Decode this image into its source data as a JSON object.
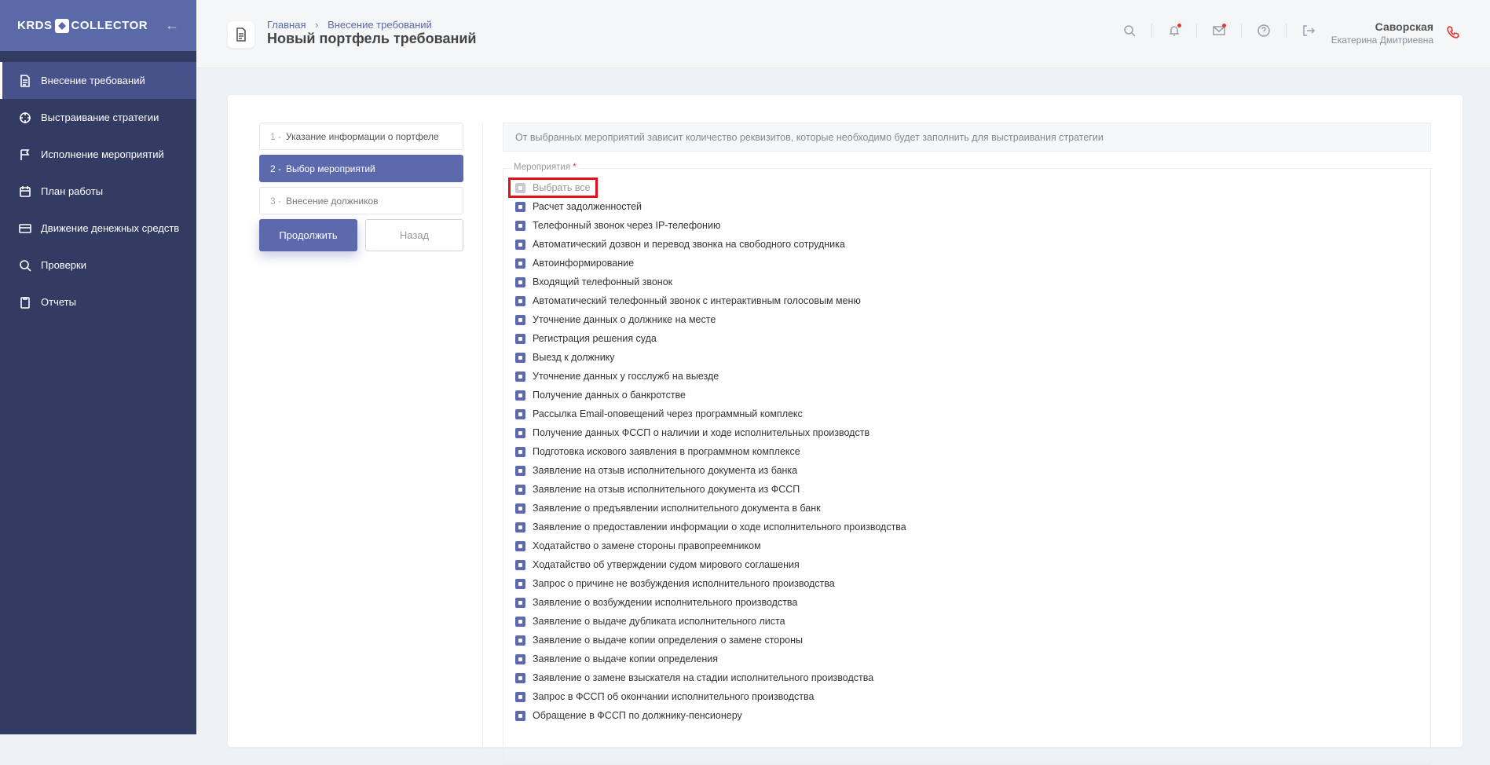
{
  "app": {
    "logo_left": "KRDS",
    "logo_right": "COLLECTOR"
  },
  "sidebar": {
    "items": [
      {
        "label": "Внесение требований",
        "icon": "document-icon",
        "active": true
      },
      {
        "label": "Выстраивание стратегии",
        "icon": "target-icon"
      },
      {
        "label": "Исполнение мероприятий",
        "icon": "flag-icon"
      },
      {
        "label": "План работы",
        "icon": "calendar-icon"
      },
      {
        "label": "Движение денежных средств",
        "icon": "card-icon"
      },
      {
        "label": "Проверки",
        "icon": "search-icon"
      },
      {
        "label": "Отчеты",
        "icon": "clipboard-icon"
      }
    ]
  },
  "header": {
    "breadcrumb_home": "Главная",
    "breadcrumb_sep": "›",
    "breadcrumb_current": "Внесение требований",
    "title": "Новый портфель требований",
    "user_last": "Саворская",
    "user_first": "Екатерина Дмитриевна"
  },
  "steps": [
    {
      "num": "1 -",
      "label": "Указание информации о портфеле"
    },
    {
      "num": "2 -",
      "label": "Выбор мероприятий"
    },
    {
      "num": "3 -",
      "label": "Внесение должников"
    }
  ],
  "buttons": {
    "continue": "Продолжить",
    "back": "Назад"
  },
  "info_text": "От выбранных мероприятий зависит количество реквизитов, которые необходимо будет заполнить для выстраивания стратегии",
  "events": {
    "legend": "Мероприятия",
    "required_mark": "*",
    "select_all": "Выбрать все",
    "items": [
      "Расчет задолженностей",
      "Телефонный звонок через IP-телефонию",
      "Автоматический дозвон и перевод звонка на свободного сотрудника",
      "Автоинформирование",
      "Входящий телефонный звонок",
      "Автоматический телефонный звонок с интерактивным голосовым меню",
      "Уточнение данных о должнике на месте",
      "Регистрация решения суда",
      "Выезд к должнику",
      "Уточнение данных у госслужб на выезде",
      "Получение данных о банкротстве",
      "Рассылка Email-оповещений через программный комплекс",
      "Получение данных ФССП о наличии и ходе исполнительных производств",
      "Подготовка искового заявления в программном комплексе",
      "Заявление на отзыв исполнительного документа из банка",
      "Заявление на отзыв исполнительного документа из ФССП",
      "Заявление о предъявлении исполнительного документа в банк",
      "Заявление о предоставлении информации о ходе исполнительного производства",
      "Ходатайство о замене стороны правопреемником",
      "Ходатайство об утверждении судом мирового соглашения",
      "Запрос о причине не возбуждения исполнительного производства",
      "Заявление о возбуждении исполнительного производства",
      "Заявление о выдаче дубликата исполнительного листа",
      "Заявление о выдаче копии определения о замене стороны",
      "Заявление о выдаче копии определения",
      "Заявление о замене взыскателя на стадии исполнительного производства",
      "Запрос в ФССП об окончании исполнительного производства",
      "Обращение в ФССП по должнику-пенсионеру"
    ]
  },
  "colors": {
    "sidebar": "#323c63",
    "sidebar_head": "#5a69a8",
    "accent": "#5d69ad",
    "highlight": "#e0111a"
  }
}
